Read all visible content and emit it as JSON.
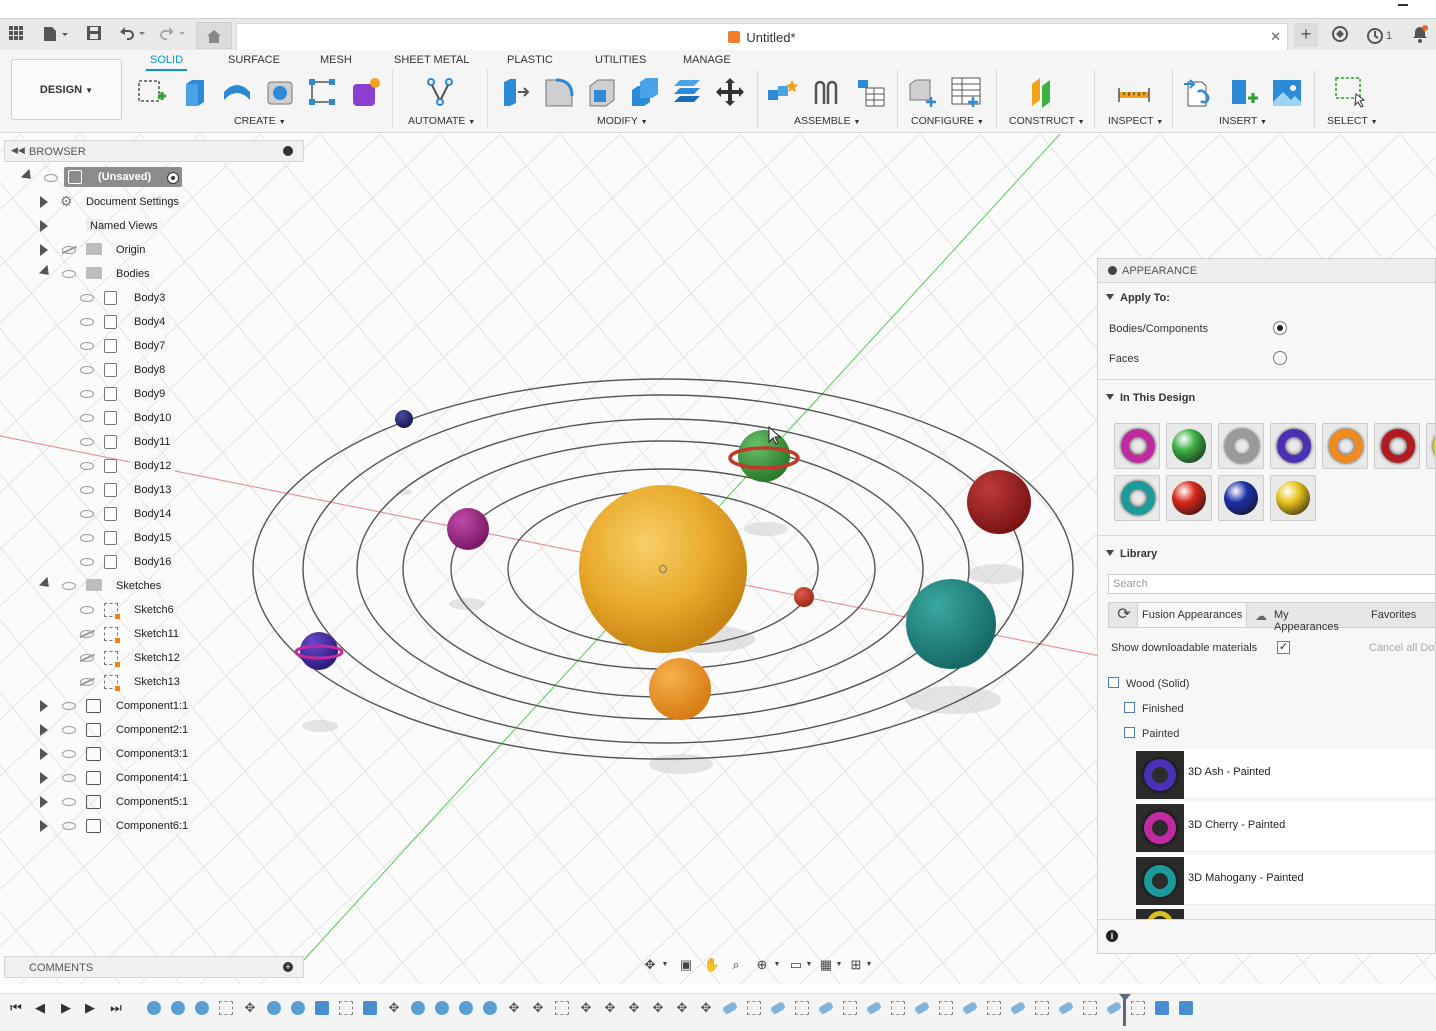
{
  "titlebar": {
    "document_title": "Untitled*",
    "notifications_count": "1",
    "icons": [
      "app-grid-icon",
      "file-icon",
      "save-icon",
      "undo-icon",
      "redo-icon",
      "home-icon",
      "new-tab-icon",
      "extensions-icon",
      "job-status-icon",
      "notification-icon"
    ]
  },
  "ribbon": {
    "workspace": "DESIGN",
    "tabs": [
      "SOLID",
      "SURFACE",
      "MESH",
      "SHEET METAL",
      "PLASTIC",
      "UTILITIES",
      "MANAGE"
    ],
    "active_tab": "SOLID",
    "groups": [
      "CREATE",
      "AUTOMATE",
      "MODIFY",
      "ASSEMBLE",
      "CONFIGURE",
      "CONSTRUCT",
      "INSPECT",
      "INSERT",
      "SELECT"
    ]
  },
  "browser": {
    "title": "BROWSER",
    "root": "(Unsaved)",
    "items": [
      {
        "label": "Document Settings",
        "kind": "settings",
        "level": 1,
        "expand": "right",
        "eye": "none"
      },
      {
        "label": "Named Views",
        "kind": "folder",
        "level": 1,
        "expand": "right",
        "eye": "none"
      },
      {
        "label": "Origin",
        "kind": "folder",
        "level": 1,
        "expand": "right",
        "eye": "off"
      },
      {
        "label": "Bodies",
        "kind": "folder",
        "level": 1,
        "expand": "down",
        "eye": "on"
      },
      {
        "label": "Body3",
        "kind": "body",
        "level": 2,
        "eye": "on"
      },
      {
        "label": "Body4",
        "kind": "body",
        "level": 2,
        "eye": "on"
      },
      {
        "label": "Body7",
        "kind": "body",
        "level": 2,
        "eye": "on"
      },
      {
        "label": "Body8",
        "kind": "body",
        "level": 2,
        "eye": "on"
      },
      {
        "label": "Body9",
        "kind": "body",
        "level": 2,
        "eye": "on"
      },
      {
        "label": "Body10",
        "kind": "body",
        "level": 2,
        "eye": "on"
      },
      {
        "label": "Body11",
        "kind": "body",
        "level": 2,
        "eye": "on"
      },
      {
        "label": "Body12",
        "kind": "body",
        "level": 2,
        "eye": "on"
      },
      {
        "label": "Body13",
        "kind": "body",
        "level": 2,
        "eye": "on"
      },
      {
        "label": "Body14",
        "kind": "body",
        "level": 2,
        "eye": "on"
      },
      {
        "label": "Body15",
        "kind": "body",
        "level": 2,
        "eye": "on"
      },
      {
        "label": "Body16",
        "kind": "body",
        "level": 2,
        "eye": "on"
      },
      {
        "label": "Sketches",
        "kind": "folder",
        "level": 1,
        "expand": "down",
        "eye": "on"
      },
      {
        "label": "Sketch6",
        "kind": "sketch",
        "level": 2,
        "eye": "on"
      },
      {
        "label": "Sketch11",
        "kind": "sketch",
        "level": 2,
        "eye": "off"
      },
      {
        "label": "Sketch12",
        "kind": "sketch",
        "level": 2,
        "eye": "off"
      },
      {
        "label": "Sketch13",
        "kind": "sketch",
        "level": 2,
        "eye": "off"
      },
      {
        "label": "Component1:1",
        "kind": "component",
        "level": 1,
        "expand": "right",
        "eye": "on"
      },
      {
        "label": "Component2:1",
        "kind": "component",
        "level": 1,
        "expand": "right",
        "eye": "on"
      },
      {
        "label": "Component3:1",
        "kind": "component",
        "level": 1,
        "expand": "right",
        "eye": "on"
      },
      {
        "label": "Component4:1",
        "kind": "component",
        "level": 1,
        "expand": "right",
        "eye": "on"
      },
      {
        "label": "Component5:1",
        "kind": "component",
        "level": 1,
        "expand": "right",
        "eye": "on"
      },
      {
        "label": "Component6:1",
        "kind": "component",
        "level": 1,
        "expand": "right",
        "eye": "on"
      }
    ]
  },
  "viewport": {
    "colors": {
      "sun": "#e8a92a",
      "x_axis": "#e36a6a",
      "y_axis": "#39c439",
      "orbit": "#444444"
    }
  },
  "appearance": {
    "title": "APPEARANCE",
    "apply_to_label": "Apply To:",
    "option_bodies": "Bodies/Components",
    "option_faces": "Faces",
    "selected_option": "Bodies/Components",
    "in_this_design_label": "In This Design",
    "swatch_colors": [
      "#c02aa0",
      "#3cb043",
      "#9a9a9a",
      "#4b2fb5",
      "#f08a1c",
      "#b01c22",
      "#d4c21a",
      "#1a9a9a",
      "#d8281c",
      "#1c2fa8",
      "#e6c41c"
    ],
    "library_label": "Library",
    "search_placeholder": "Search",
    "tabs": [
      "Fusion Appearances",
      "My Appearances",
      "Favorites"
    ],
    "show_downloadable_label": "Show downloadable materials",
    "show_downloadable_checked": "✓",
    "cancel_all_label": "Cancel all Dov",
    "tree": [
      "Wood (Solid)",
      "Finished",
      "Painted"
    ],
    "materials": [
      {
        "name": "3D Ash - Painted",
        "color": "#4b2fb5"
      },
      {
        "name": "3D Cherry - Painted",
        "color": "#c02aa0"
      },
      {
        "name": "3D Mahogany - Painted",
        "color": "#1a9a9a"
      }
    ]
  },
  "comments": {
    "title": "COMMENTS"
  },
  "timeline": {
    "controls": [
      "first",
      "previous",
      "play",
      "next",
      "last"
    ]
  }
}
